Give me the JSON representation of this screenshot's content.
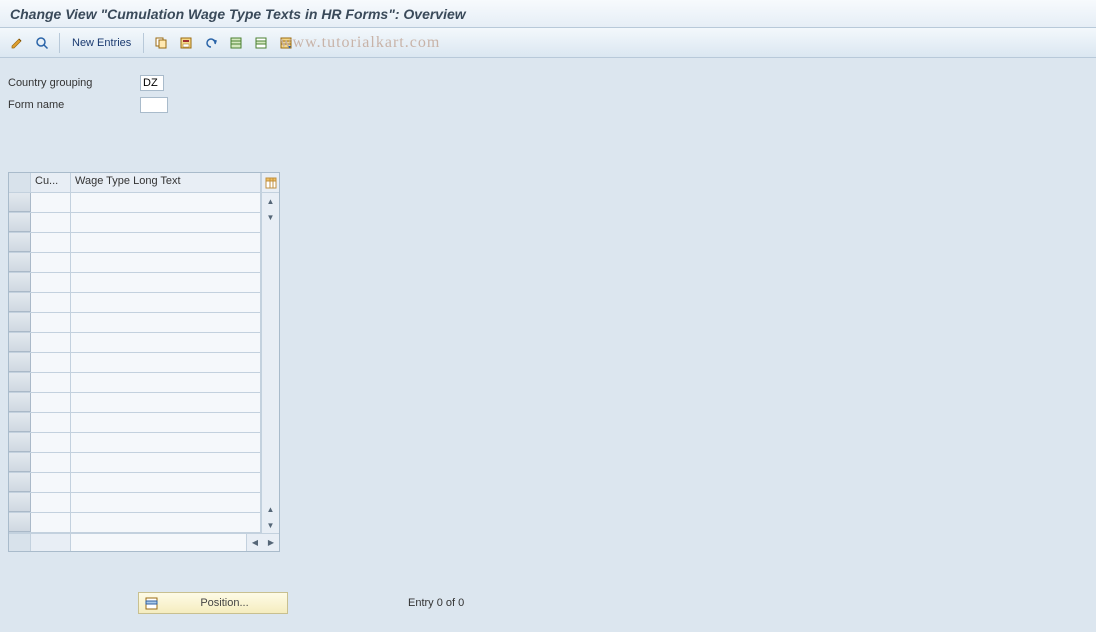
{
  "title": "Change View \"Cumulation Wage Type Texts in HR Forms\": Overview",
  "toolbar": {
    "new_entries": "New Entries"
  },
  "watermark": "www.tutorialkart.com",
  "fields": {
    "country_grouping_label": "Country grouping",
    "country_grouping_value": "DZ",
    "form_name_label": "Form name",
    "form_name_value": ""
  },
  "table": {
    "col_cu": "Cu...",
    "col_long": "Wage Type Long Text"
  },
  "footer": {
    "position_label": "Position...",
    "entry_text": "Entry 0 of 0"
  }
}
